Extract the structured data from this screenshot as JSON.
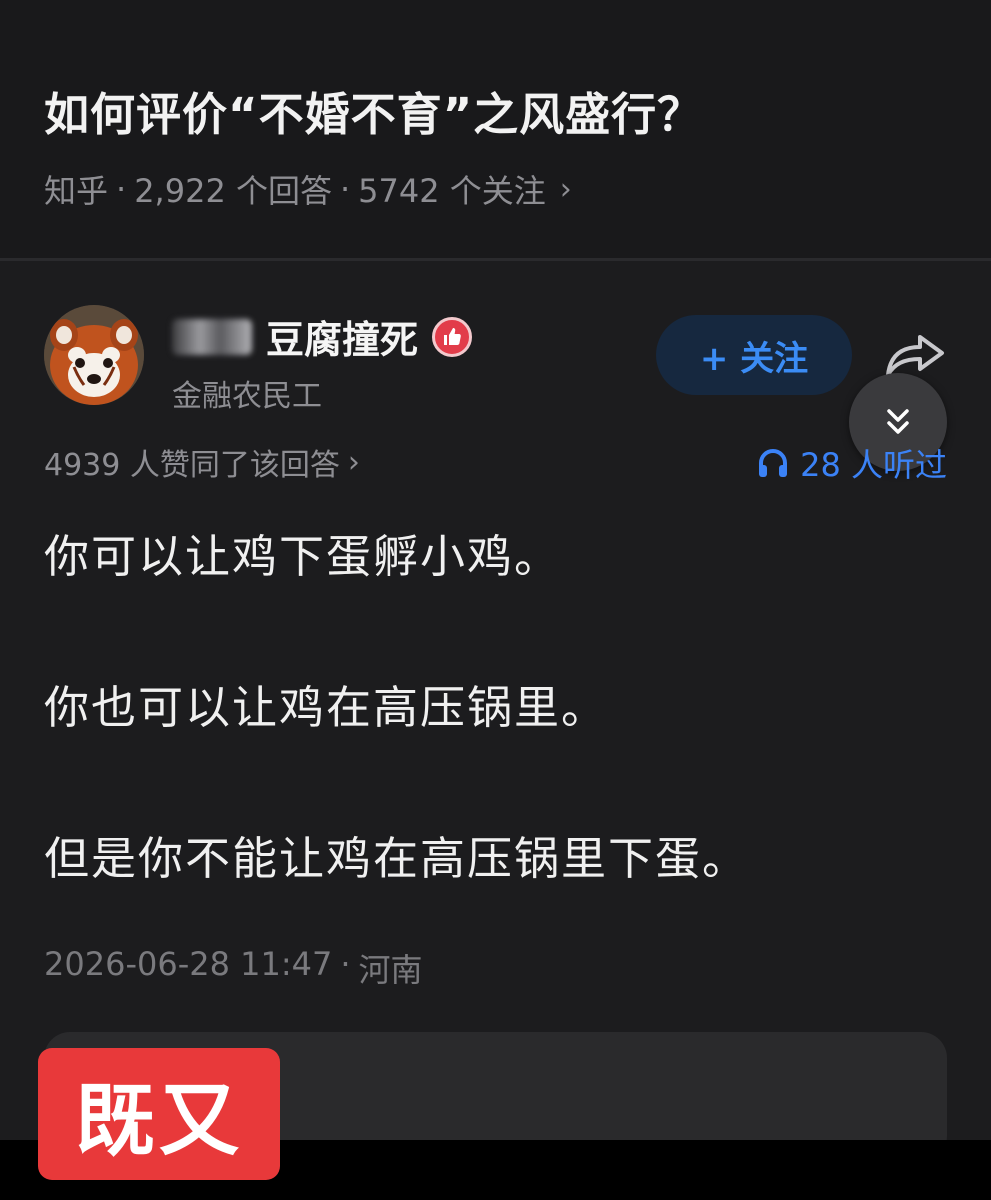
{
  "question": {
    "title": "如何评价“不婚不育”之风盛行？",
    "source": "知乎",
    "answers": "2,922 个回答",
    "followers": "5742 个关注",
    "separator": "·",
    "chevron": "›"
  },
  "author": {
    "name": "豆腐撞死",
    "subtitle": "金融农民工",
    "follow_label": "+ 关注"
  },
  "stats": {
    "votes": "4939 人赞同了该回答",
    "votes_chevron": "›",
    "listened": "28 人听过"
  },
  "answer": {
    "paragraphs": [
      "你可以让鸡下蛋孵小鸡。",
      "你也可以让鸡在高压锅里。",
      "但是你不能让鸡在高压锅里下蛋。"
    ],
    "date": "2026-06-28 11:47",
    "location": "河南"
  },
  "overlay": {
    "stamp_text": "既又"
  },
  "icons": {
    "badge": "thumbs-up-badge-icon",
    "share": "share-arrow-icon",
    "collapse": "double-chevron-down-icon",
    "listen": "headphones-icon"
  },
  "colors": {
    "background": "#1c1c1e",
    "accent_blue": "#3b82f6",
    "badge_red": "#e23c4a",
    "stamp_red": "#e8393a"
  }
}
